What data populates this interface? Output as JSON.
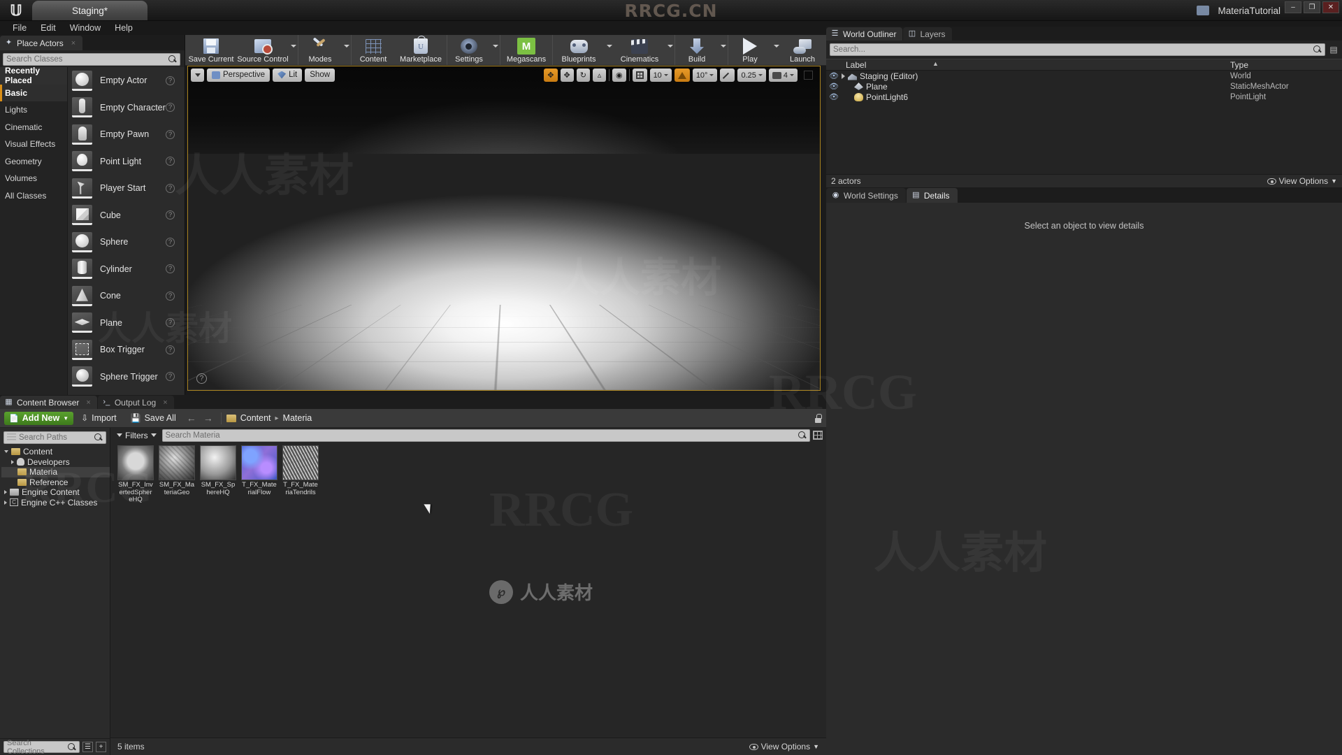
{
  "titlebar": {
    "project_tab": "Staging*",
    "center_watermark": "RRCG.CN",
    "right_label": "MateriaTutorial",
    "min": "–",
    "max": "❐",
    "close": "✕"
  },
  "menubar": {
    "items": [
      "File",
      "Edit",
      "Window",
      "Help"
    ]
  },
  "place_actors": {
    "tab_label": "Place Actors",
    "tab_close": "×",
    "search_placeholder": "Search Classes",
    "categories": [
      {
        "label": "Recently Placed",
        "selected": false,
        "header": true
      },
      {
        "label": "Basic",
        "selected": true,
        "header": false
      },
      {
        "label": "Lights",
        "selected": false,
        "header": false
      },
      {
        "label": "Cinematic",
        "selected": false,
        "header": false
      },
      {
        "label": "Visual Effects",
        "selected": false,
        "header": false
      },
      {
        "label": "Geometry",
        "selected": false,
        "header": false
      },
      {
        "label": "Volumes",
        "selected": false,
        "header": false
      },
      {
        "label": "All Classes",
        "selected": false,
        "header": false
      }
    ],
    "actors": [
      {
        "label": "Empty Actor",
        "icon": "sphere-shape-icon",
        "shape": "sh-sphere"
      },
      {
        "label": "Empty Character",
        "icon": "character-shape-icon",
        "shape": "sh-person"
      },
      {
        "label": "Empty Pawn",
        "icon": "pawn-shape-icon",
        "shape": "sh-pawn"
      },
      {
        "label": "Point Light",
        "icon": "lightbulb-icon",
        "shape": "sh-bulb"
      },
      {
        "label": "Player Start",
        "icon": "flag-icon",
        "shape": "sh-flag"
      },
      {
        "label": "Cube",
        "icon": "cube-shape-icon",
        "shape": "sh-cube"
      },
      {
        "label": "Sphere",
        "icon": "sphere-shape-icon",
        "shape": "sh-sphere"
      },
      {
        "label": "Cylinder",
        "icon": "cylinder-shape-icon",
        "shape": "sh-cyl"
      },
      {
        "label": "Cone",
        "icon": "cone-shape-icon",
        "shape": "sh-cone"
      },
      {
        "label": "Plane",
        "icon": "plane-shape-icon",
        "shape": "sh-plane"
      },
      {
        "label": "Box Trigger",
        "icon": "box-trigger-icon",
        "shape": "sh-box"
      },
      {
        "label": "Sphere Trigger",
        "icon": "sphere-trigger-icon",
        "shape": "sh-sphtrig"
      }
    ],
    "help_glyph": "?"
  },
  "toolbar": {
    "items": [
      {
        "label": "Save Current",
        "icon": "floppy-disk-icon",
        "caret": false,
        "cls": "icon-floppy"
      },
      {
        "label": "Source Control",
        "icon": "source-control-icon",
        "caret": true,
        "cls": "icon-src"
      },
      {
        "label": "Modes",
        "icon": "modes-wrench-icon",
        "caret": true,
        "cls": "icon-modes"
      },
      {
        "label": "Content",
        "icon": "content-browser-icon",
        "caret": false,
        "cls": "icon-content"
      },
      {
        "label": "Marketplace",
        "icon": "marketplace-bag-icon",
        "caret": false,
        "cls": "icon-market"
      },
      {
        "label": "Settings",
        "icon": "settings-gear-icon",
        "caret": true,
        "cls": "icon-settings"
      },
      {
        "label": "Megascans",
        "icon": "megascans-icon",
        "caret": false,
        "cls": "icon-mega"
      },
      {
        "label": "Blueprints",
        "icon": "blueprints-icon",
        "caret": true,
        "cls": "icon-bp"
      },
      {
        "label": "Cinematics",
        "icon": "cinematics-clapper-icon",
        "caret": true,
        "cls": "icon-cine"
      },
      {
        "label": "Build",
        "icon": "build-icon",
        "caret": true,
        "cls": "icon-build"
      },
      {
        "label": "Play",
        "icon": "play-icon",
        "caret": true,
        "cls": "icon-play"
      },
      {
        "label": "Launch",
        "icon": "launch-icon",
        "caret": true,
        "cls": "icon-launch"
      }
    ]
  },
  "viewport": {
    "menu_caret": "▾",
    "perspective_label": "Perspective",
    "lit_label": "Lit",
    "show_label": "Show",
    "grid_snap_value": "10",
    "rotation_snap_value": "10°",
    "scale_snap_value": "0.25",
    "camera_speed_value": "4",
    "help_glyph": "?"
  },
  "outliner": {
    "tab_label": "World Outliner",
    "layers_tab_label": "Layers",
    "search_placeholder": "Search...",
    "columns": {
      "label": "Label",
      "type": "Type"
    },
    "rows": [
      {
        "label": "Staging (Editor)",
        "type": "World",
        "indent": 0,
        "icon": "world-icon",
        "icon_cls": "ico-world",
        "has_disclosure": true
      },
      {
        "label": "Plane",
        "type": "StaticMeshActor",
        "indent": 1,
        "icon": "plane-mesh-icon",
        "icon_cls": "ico-plane",
        "has_disclosure": false
      },
      {
        "label": "PointLight6",
        "type": "PointLight",
        "indent": 1,
        "icon": "point-light-icon",
        "icon_cls": "ico-light",
        "has_disclosure": false
      }
    ],
    "footer_count": "2 actors",
    "view_options": "View Options"
  },
  "details": {
    "world_settings_tab": "World Settings",
    "details_tab": "Details",
    "empty_message": "Select an object to view details"
  },
  "content_browser": {
    "tab_label": "Content Browser",
    "output_log_tab": "Output Log",
    "tab_close": "×",
    "add_new_label": "Add New",
    "import_label": "Import",
    "save_all_label": "Save All",
    "back_arrow": "←",
    "forward_arrow": "→",
    "breadcrumb": [
      "Content",
      "Materia"
    ],
    "breadcrumb_sep": "▸",
    "paths_search_placeholder": "Search Paths",
    "asset_search_placeholder": "Search Materia",
    "filters_label": "Filters",
    "collections_placeholder": "Search Collections",
    "tree": [
      {
        "label": "Content",
        "depth": 0,
        "disc": "open",
        "icon": "folder-icon",
        "selected": false
      },
      {
        "label": "Developers",
        "depth": 1,
        "disc": "closed",
        "icon": "developer-icon",
        "selected": false
      },
      {
        "label": "Materia",
        "depth": 1,
        "disc": "none",
        "icon": "folder-icon",
        "selected": true
      },
      {
        "label": "Reference",
        "depth": 1,
        "disc": "none",
        "icon": "folder-icon",
        "selected": false
      },
      {
        "label": "Engine Content",
        "depth": 0,
        "disc": "closed",
        "icon": "folder-icon",
        "selected": false
      },
      {
        "label": "Engine C++ Classes",
        "depth": 0,
        "disc": "closed",
        "icon": "cpp-icon",
        "selected": false
      }
    ],
    "assets": [
      {
        "name": "SM_FX_InvertedSphereHQ",
        "thumb": "th-invsphere"
      },
      {
        "name": "SM_FX_MateriaGeo",
        "thumb": "th-geo"
      },
      {
        "name": "SM_FX_SphereHQ",
        "thumb": "th-sphhq"
      },
      {
        "name": "T_FX_MaterialFlow",
        "thumb": "th-flow"
      },
      {
        "name": "T_FX_MateriaTendrils",
        "thumb": "th-tendrils"
      }
    ],
    "item_count": "5 items",
    "view_options": "View Options"
  },
  "watermarks": {
    "brand": "人人素材",
    "rrcg": "RRCG",
    "center_mark": "人人素材",
    "center_logo": "℘"
  },
  "colors": {
    "accent_orange": "#d98e17",
    "green_add": "#4e8f26",
    "viewport_border": "#a8821f",
    "megascans_green": "#7cc043"
  }
}
